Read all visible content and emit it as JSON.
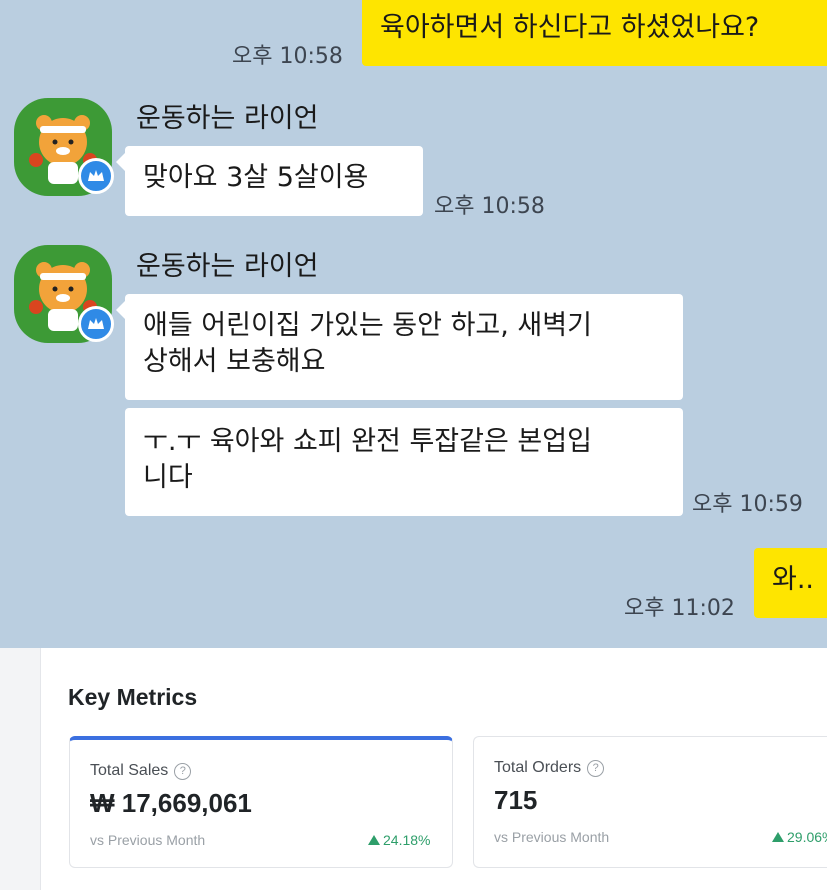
{
  "chat": {
    "messages": [
      {
        "text": "육아하면서 하신다고 하셨었나요?",
        "time": "오후 10:58"
      },
      {
        "sender": "운동하는 라이언",
        "text": "맞아요 3살 5살이용",
        "time": "오후 10:58"
      },
      {
        "sender": "운동하는 라이언",
        "lines": [
          "애들 어린이집 가있는 동안 하고, 새벽기",
          "상해서 보충해요"
        ],
        "lines2": [
          "ㅜ.ㅜ 육아와 쇼피 완전 투잡같은 본업입",
          "니다"
        ],
        "time": "오후 10:59"
      },
      {
        "text": "와..",
        "time": "오후 11:02"
      }
    ]
  },
  "metrics": {
    "title": "Key Metrics",
    "cards": [
      {
        "label": "Total Sales",
        "value": "₩ 17,669,061",
        "compare": "vs Previous Month",
        "change": "24.18%"
      },
      {
        "label": "Total Orders",
        "value": "715",
        "compare": "vs Previous Month",
        "change": "29.06%"
      }
    ]
  },
  "colors": {
    "chat_bg": "#bacee0",
    "my_bubble": "#fee500",
    "their_bubble": "#ffffff",
    "accent": "#3b6fe0",
    "positive": "#2e9e6a"
  },
  "icons": [
    "ryan-avatar-icon",
    "crown-badge-icon",
    "help-icon",
    "triangle-up-icon"
  ]
}
